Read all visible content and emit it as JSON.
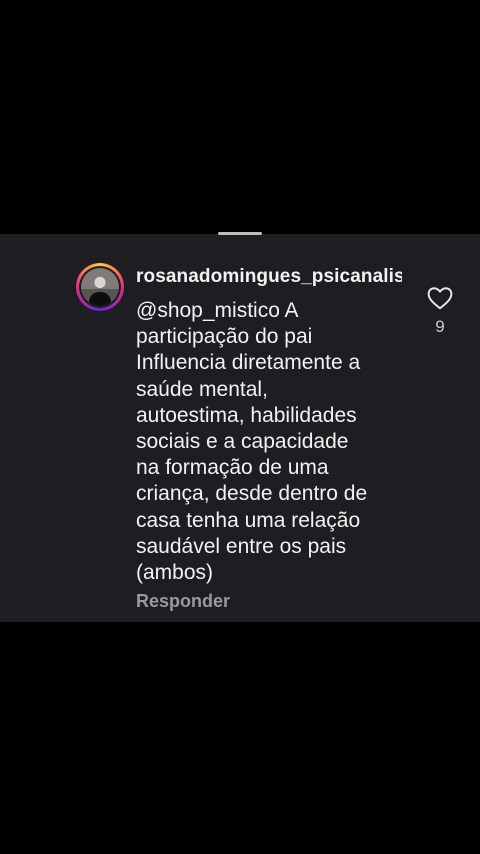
{
  "comment": {
    "username": "rosanadomingues_psicanalis",
    "mention": "@shop_mistico",
    "text_lines": [
      "@shop_mistico A",
      "participação do pai",
      "Influencia diretamente a",
      "saúde mental,",
      "autoestima, habilidades",
      "sociais e a capacidade",
      "na formação de uma",
      "criança, desde dentro de",
      "casa tenha uma relação",
      "saudável entre os pais",
      "(ambos)"
    ],
    "reply_label": "Responder",
    "like_count": "9"
  },
  "icons": {
    "like": "heart-outline-icon",
    "mention": "threads-at-icon"
  },
  "colors": {
    "background": "#000000",
    "card": "#1e1e22",
    "text": "#f2f2f2",
    "muted": "#9a9a9e",
    "avatar_ring": [
      "#f9ce34",
      "#ee2a7b",
      "#6228d7"
    ]
  }
}
